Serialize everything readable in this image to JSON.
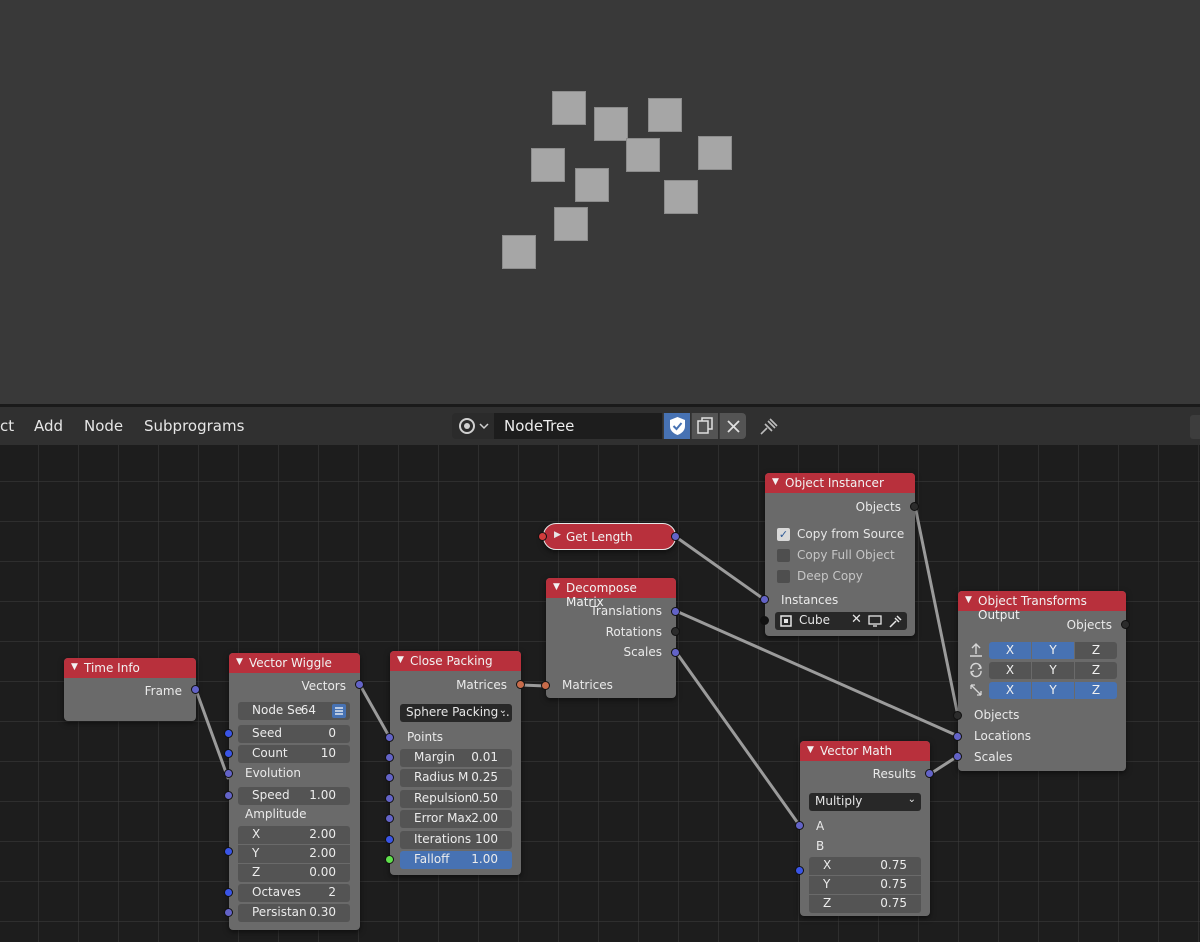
{
  "menu": {
    "object": "ct",
    "add": "Add",
    "node": "Node",
    "subprograms": "Subprograms"
  },
  "tree": {
    "name": "NodeTree"
  },
  "nodes": {
    "time_info": {
      "title": "Time Info",
      "out_frame": "Frame"
    },
    "vector_wiggle": {
      "title": "Vector Wiggle",
      "out_vectors": "Vectors",
      "node_seed_label": "Node Se",
      "node_seed_value": "64",
      "seed_label": "Seed",
      "seed_value": "0",
      "count_label": "Count",
      "count_value": "10",
      "evolution": "Evolution",
      "speed_label": "Speed",
      "speed_value": "1.00",
      "amplitude": "Amplitude",
      "x_label": "X",
      "x_value": "2.00",
      "y_label": "Y",
      "y_value": "2.00",
      "z_label": "Z",
      "z_value": "0.00",
      "octaves_label": "Octaves",
      "octaves_value": "2",
      "persistance_label": "Persistan",
      "persistance_value": "0.30"
    },
    "close_packing": {
      "title": "Close Packing",
      "out_matrices": "Matrices",
      "mode": "Sphere Packing ..",
      "points": "Points",
      "margin_label": "Margin",
      "margin_value": "0.01",
      "radius_label": "Radius M",
      "radius_value": "0.25",
      "repulsion_label": "Repulsion",
      "repulsion_value": "0.50",
      "error_label": "Error Max",
      "error_value": "2.00",
      "iterations_label": "Iterations",
      "iterations_value": "100",
      "falloff_label": "Falloff",
      "falloff_value": "1.00"
    },
    "get_length": {
      "title": "Get Length"
    },
    "decompose_matrix": {
      "title": "Decompose Matrix",
      "in_matrices": "Matrices",
      "out_translations": "Translations",
      "out_rotations": "Rotations",
      "out_scales": "Scales"
    },
    "object_instancer": {
      "title": "Object Instancer",
      "out_objects": "Objects",
      "copy_from_source": "Copy from Source",
      "copy_full_object": "Copy Full Object",
      "deep_copy": "Deep Copy",
      "instances": "Instances",
      "object_value": "Cube"
    },
    "vector_math": {
      "title": "Vector Math",
      "out_results": "Results",
      "operation": "Multiply",
      "a_label": "A",
      "b_label": "B",
      "x_label": "X",
      "x_value": "0.75",
      "y_label": "Y",
      "y_value": "0.75",
      "z_label": "Z",
      "z_value": "0.75"
    },
    "object_transforms_output": {
      "title": "Object Transforms Output",
      "in_objects": "Objects",
      "row_location": [
        "X",
        "Y",
        "Z"
      ],
      "row_rotation": [
        "X",
        "Y",
        "Z"
      ],
      "row_scale": [
        "X",
        "Y",
        "Z"
      ],
      "objects": "Objects",
      "locations": "Locations",
      "scales": "Scales"
    }
  },
  "colors": {
    "node_header": "#b8303c",
    "accent": "#4772b3",
    "node_body": "#6a6a6a"
  }
}
